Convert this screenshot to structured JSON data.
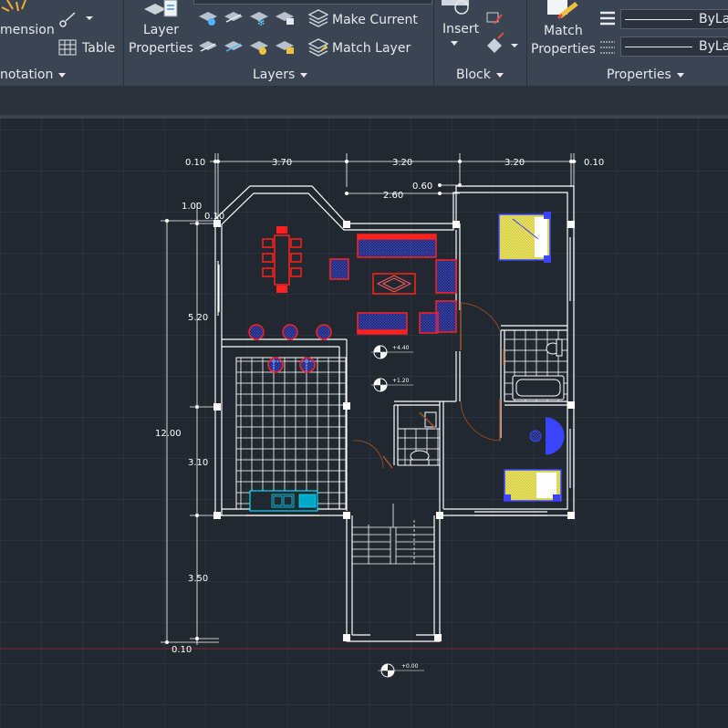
{
  "ribbon": {
    "annotation": {
      "dimension_label": "mension",
      "table_label": "Table",
      "panel_label": "notation"
    },
    "layer_properties": {
      "line1": "Layer",
      "line2": "Properties"
    },
    "layers": {
      "make_current": "Make Current",
      "match_layer": "Match Layer",
      "panel_label": "Layers"
    },
    "block": {
      "insert_label": "Insert",
      "panel_label": "Block"
    },
    "properties": {
      "match_line1": "Match",
      "match_line2": "Properties",
      "bylayer1": "ByLa",
      "bylayer2": "ByLa",
      "panel_label": "Properties"
    }
  },
  "drawing": {
    "dims": {
      "top_left": "0.10",
      "top_a": "3.70",
      "top_b": "3.20",
      "top_c": "3.20",
      "top_right": "0.10",
      "second_a": "0.60",
      "second_b": "2.60",
      "left_a": "1.00",
      "left_b": "0.10",
      "left_c": "5.20",
      "left_total": "12.00",
      "left_d": "3.10",
      "left_e": "3.50",
      "left_bottom": "0.10"
    },
    "elevations": {
      "e1": "+4.40",
      "e2": "+1.20",
      "e3": "+0.00"
    }
  },
  "colors": {
    "ribbon_bg": "#3b4453",
    "canvas_bg": "#212830",
    "wall": "#ffffff",
    "furniture": "#ff2020",
    "fabric": "#3a44ff",
    "bed": "#e8e060",
    "kitchen": "#00e0ff",
    "door": "#a0522d"
  },
  "icons": [
    "dimension-icon",
    "leader-icon",
    "table-icon",
    "layer-properties-icon",
    "layer-state-icons",
    "make-current-icon",
    "match-layer-icon",
    "insert-icon",
    "block-editor-icon",
    "match-properties-icon",
    "lineweight-icon",
    "linetype-icon"
  ]
}
